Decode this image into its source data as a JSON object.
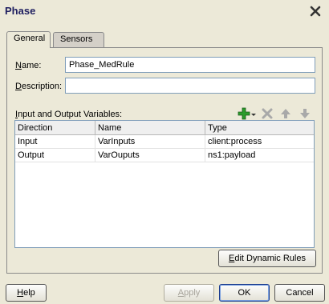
{
  "dialog": {
    "title": "Phase"
  },
  "tabs": [
    {
      "label": "General",
      "active": true
    },
    {
      "label": "Sensors",
      "active": false
    }
  ],
  "form": {
    "name_label": "Name:",
    "name_value": "Phase_MedRule",
    "description_label": "Description:",
    "description_value": ""
  },
  "variables": {
    "label": "Input and Output Variables:",
    "columns": [
      "Direction",
      "Name",
      "Type"
    ],
    "rows": [
      [
        "Input",
        "VarInputs",
        "client:process"
      ],
      [
        "Output",
        "VarOuputs",
        "ns1:payload"
      ]
    ],
    "toolbar_icons": [
      "add-icon",
      "delete-icon",
      "move-up-icon",
      "move-down-icon"
    ]
  },
  "buttons": {
    "edit_dynamic_rules": "Edit Dynamic Rules",
    "help": "Help",
    "apply": "Apply",
    "ok": "OK",
    "cancel": "Cancel"
  },
  "colors": {
    "background": "#ece9d8",
    "title": "#1f1f60",
    "add_icon": "#2c9b2c",
    "disabled_icon": "#a9a9a9"
  }
}
